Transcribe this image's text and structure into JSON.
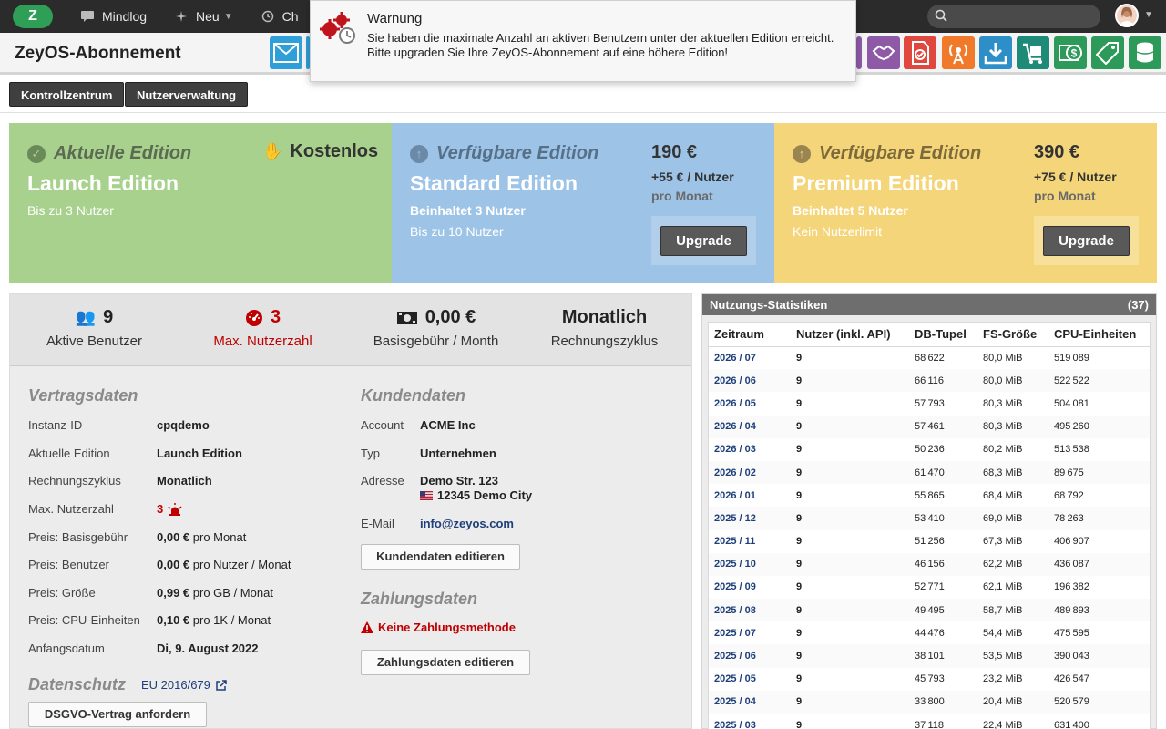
{
  "topbar": {
    "nav": [
      {
        "label": "Mindlog",
        "icon": "chat-icon"
      },
      {
        "label": "Neu",
        "icon": "sparkle-icon",
        "has_menu": true
      },
      {
        "label": "Ch",
        "icon": "history-icon"
      }
    ],
    "search": {
      "placeholder": ""
    }
  },
  "toast": {
    "title": "Warnung",
    "message": [
      "Sie haben die maximale Anzahl an aktiven Benutzern unter der aktuellen Edition erreicht.",
      "Bitte upgraden Sie Ihre ZeyOS-Abonnement auf eine höhere Edition!"
    ]
  },
  "header": {
    "title": "ZeyOS-Abonnement",
    "app_icons": [
      {
        "name": "mail-icon",
        "color": "#2e9fd8"
      },
      {
        "name": "app-icon",
        "color": "#2e9fd8"
      },
      {
        "name": "app-purple-icon",
        "color": "#8e5aa8"
      },
      {
        "name": "handshake-icon",
        "color": "#8e5aa8"
      },
      {
        "name": "document-check-icon",
        "color": "#e0473e"
      },
      {
        "name": "broadcast-icon",
        "color": "#f07a2a"
      },
      {
        "name": "download-icon",
        "color": "#2e8fc8"
      },
      {
        "name": "cart-icon",
        "color": "#1e8b78"
      },
      {
        "name": "money-icon",
        "color": "#2e9a5a"
      },
      {
        "name": "price-tag-icon",
        "color": "#2e9a5a"
      },
      {
        "name": "database-icon",
        "color": "#2e9a5a"
      }
    ]
  },
  "buttons": {
    "control_center": "Kontrollzentrum",
    "user_management": "Nutzerverwaltung"
  },
  "editions": {
    "current": {
      "subtitle": "Aktuelle Edition",
      "name": "Launch Edition",
      "line1": "Bis zu 3 Nutzer",
      "price_label": "Kostenlos"
    },
    "standard": {
      "subtitle": "Verfügbare Edition",
      "name": "Standard Edition",
      "line1": "Beinhaltet 3 Nutzer",
      "line2": "Bis zu 10 Nutzer",
      "price": "190 €",
      "per_user": "+55 € / Nutzer",
      "per_month": "pro Monat",
      "button": "Upgrade"
    },
    "premium": {
      "subtitle": "Verfügbare Edition",
      "name": "Premium Edition",
      "line1": "Beinhaltet 5 Nutzer",
      "line2": "Kein Nutzerlimit",
      "price": "390 €",
      "per_user": "+75 € / Nutzer",
      "per_month": "pro Monat",
      "button": "Upgrade"
    }
  },
  "stats": [
    {
      "value": "9",
      "label": "Aktive Benutzer",
      "icon": "users-icon"
    },
    {
      "value": "3",
      "label": "Max. Nutzerzahl",
      "icon": "gauge-icon"
    },
    {
      "value": "0,00 €",
      "label": "Basisgebühr / Month",
      "icon": "banknote-icon"
    },
    {
      "value": "Monatlich",
      "label": "Rechnungszyklus"
    }
  ],
  "contract": {
    "title": "Vertragsdaten",
    "rows": [
      {
        "key": "Instanz-ID",
        "value": "cpqdemo"
      },
      {
        "key": "Aktuelle Edition",
        "value": "Launch Edition"
      },
      {
        "key": "Rechnungszyklus",
        "value": "Monatlich"
      },
      {
        "key": "Max. Nutzerzahl",
        "value": "3"
      },
      {
        "key": "Preis: Basisgebühr",
        "value": "0,00 €",
        "unit": "pro Monat"
      },
      {
        "key": "Preis: Benutzer",
        "value": "0,00 €",
        "unit": "pro Nutzer / Monat"
      },
      {
        "key": "Preis: Größe",
        "value": "0,99 €",
        "unit": "pro GB / Monat"
      },
      {
        "key": "Preis: CPU-Einheiten",
        "value": "0,10 €",
        "unit": "pro 1K / Monat"
      },
      {
        "key": "Anfangsdatum",
        "value": "Di, 9. August 2022"
      }
    ]
  },
  "privacy": {
    "title": "Datenschutz",
    "link": "EU 2016/679",
    "button": "DSGVO-Vertrag anfordern"
  },
  "customer": {
    "title": "Kundendaten",
    "account_label": "Account",
    "account": "ACME Inc",
    "type_label": "Typ",
    "type": "Unternehmen",
    "address_label": "Adresse",
    "address1": "Demo Str. 123",
    "address2": "12345 Demo City",
    "email_label": "E-Mail",
    "email": "info@zeyos.com",
    "edit_button": "Kundendaten editieren"
  },
  "payment": {
    "title": "Zahlungsdaten",
    "warning": "Keine Zahlungsmethode",
    "edit_button": "Zahlungsdaten editieren"
  },
  "usage": {
    "title": "Nutzungs-Statistiken",
    "count": "(37)",
    "columns": [
      "Zeitraum",
      "Nutzer (inkl. API)",
      "DB-Tupel",
      "FS-Größe",
      "CPU-Einheiten"
    ],
    "rows": [
      [
        "2026 / 07",
        "9",
        "68622",
        "80,0 MiB",
        "519089"
      ],
      [
        "2026 / 06",
        "9",
        "66116",
        "80,0 MiB",
        "522522"
      ],
      [
        "2026 / 05",
        "9",
        "57793",
        "80,3 MiB",
        "504081"
      ],
      [
        "2026 / 04",
        "9",
        "57461",
        "80,3 MiB",
        "495260"
      ],
      [
        "2026 / 03",
        "9",
        "50236",
        "80,2 MiB",
        "513538"
      ],
      [
        "2026 / 02",
        "9",
        "61470",
        "68,3 MiB",
        "89675"
      ],
      [
        "2026 / 01",
        "9",
        "55865",
        "68,4 MiB",
        "68792"
      ],
      [
        "2025 / 12",
        "9",
        "53410",
        "69,0 MiB",
        "78263"
      ],
      [
        "2025 / 11",
        "9",
        "51256",
        "67,3 MiB",
        "406907"
      ],
      [
        "2025 / 10",
        "9",
        "46156",
        "62,2 MiB",
        "436087"
      ],
      [
        "2025 / 09",
        "9",
        "52771",
        "62,1 MiB",
        "196382"
      ],
      [
        "2025 / 08",
        "9",
        "49495",
        "58,7 MiB",
        "489893"
      ],
      [
        "2025 / 07",
        "9",
        "44476",
        "54,4 MiB",
        "475595"
      ],
      [
        "2025 / 06",
        "9",
        "38101",
        "53,5 MiB",
        "390043"
      ],
      [
        "2025 / 05",
        "9",
        "45793",
        "23,2 MiB",
        "426547"
      ],
      [
        "2025 / 04",
        "9",
        "33800",
        "20,4 MiB",
        "520579"
      ],
      [
        "2025 / 03",
        "9",
        "37118",
        "22,4 MiB",
        "631400"
      ]
    ]
  }
}
